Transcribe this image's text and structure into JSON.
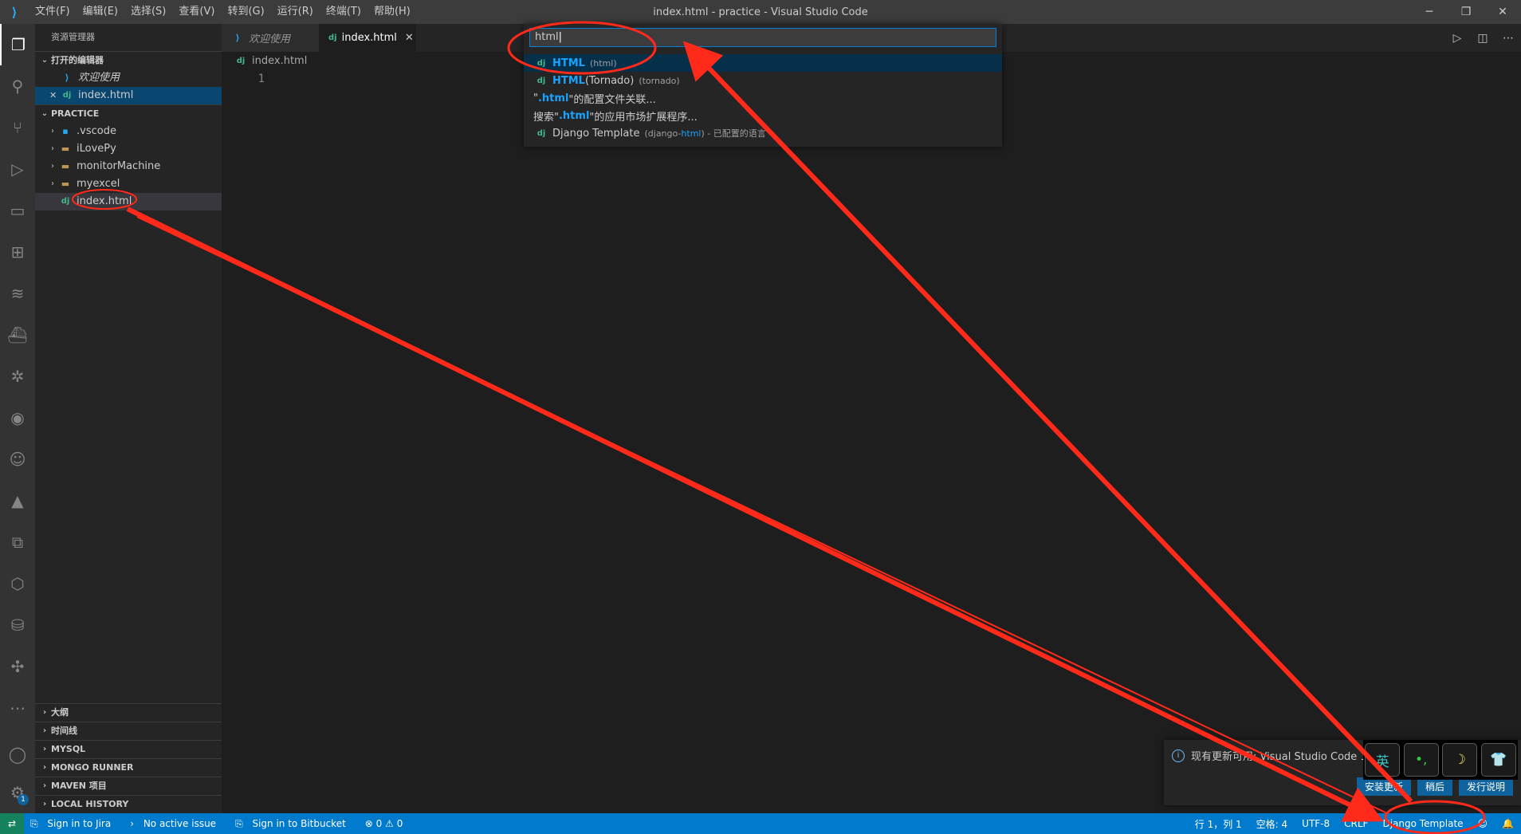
{
  "window": {
    "title": "index.html - practice - Visual Studio Code",
    "app_icon": "vscode-icon",
    "controls": {
      "minimize": "─",
      "restore": "❐",
      "close": "✕"
    }
  },
  "menu": [
    "文件(F)",
    "编辑(E)",
    "选择(S)",
    "查看(V)",
    "转到(G)",
    "运行(R)",
    "终端(T)",
    "帮助(H)"
  ],
  "sidebar": {
    "title": "资源管理器",
    "open_editors": {
      "label": "打开的编辑器",
      "items": [
        {
          "name": "欢迎使用",
          "icon": "vscode-icon"
        },
        {
          "name": "index.html",
          "icon": "django-icon"
        }
      ]
    },
    "practice": {
      "label": "PRACTICE",
      "items": [
        ".vscode",
        "iLovePy",
        "monitorMachine",
        "myexcel"
      ],
      "file": "index.html"
    },
    "bottom_sections": [
      "大纲",
      "时间线",
      "MYSQL",
      "MONGO RUNNER",
      "MAVEN 项目",
      "LOCAL HISTORY"
    ]
  },
  "tabs": [
    {
      "label": "欢迎使用",
      "active": false
    },
    {
      "label": "index.html",
      "active": true
    }
  ],
  "breadcrumb": "index.html",
  "editor": {
    "line_numbers": [
      "1"
    ]
  },
  "file_badge": "dj",
  "quickpick": {
    "input": "html",
    "items": [
      {
        "hl": "HTML",
        "rest": "",
        "desc": "(html)"
      },
      {
        "hl": "HTML",
        "rest": " (Tornado)",
        "desc": "(tornado)"
      },
      {
        "pre": "\"",
        "hl": ".html",
        "post": "\"的配置文件关联..."
      },
      {
        "pre": "搜索\"",
        "hl": ".html",
        "post": "\"的应用市场扩展程序..."
      },
      {
        "label": "Django Template",
        "desc_pre": "(django-",
        "desc_hl": "html",
        "desc_post": ") - 已配置的语言"
      }
    ]
  },
  "notification": {
    "message": "现有更新可用: Visual Studio Code 1.47",
    "buttons": [
      "安装更新",
      "稍后",
      "发行说明"
    ]
  },
  "ime": [
    "英",
    "•,",
    "☽",
    "👕"
  ],
  "statusbar": {
    "left": [
      "Sign in to Jira",
      "No active issue",
      "Sign in to Bitbucket",
      "⊗ 0 ⚠ 0"
    ],
    "right": [
      "行 1，列 1",
      "空格: 4",
      "UTF-8",
      "CRLF",
      "Django Template"
    ]
  },
  "colors": {
    "accent": "#007acc",
    "annotation": "#ff2a1a",
    "highlight": "#18a3ff"
  }
}
